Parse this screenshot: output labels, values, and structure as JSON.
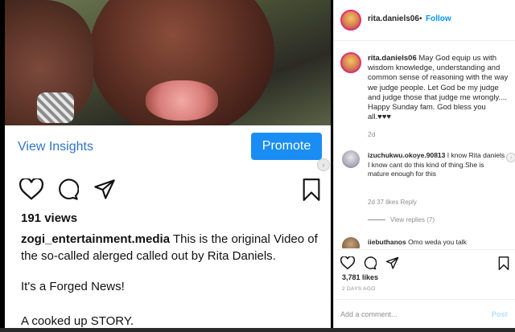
{
  "left_post": {
    "insights_label": "View Insights",
    "promote_label": "Promote",
    "views": "191 views",
    "caption_user": "zogi_entertainment.media",
    "caption_text": " This is the original Video of the so-called alerged called out by Rita Daniels.",
    "line2": "It's a Forged News!",
    "line3": "A cooked up STORY."
  },
  "right_panel": {
    "header": {
      "username": "rita.daniels06",
      "separator": "•",
      "follow_label": "Follow"
    },
    "comments": [
      {
        "username": "rita.daniels06",
        "text": " May God equip us with wisdom knowledge, understanding and common sense of reasoning with the way we judge people. Let God be my judge and judge those that judge me wrongly.... Happy Sunday fam. God bless you all.♥♥♥",
        "time": "2d"
      },
      {
        "username": "izuchukwu.okoye.90813",
        "text": " I know Rita daniels I know cant do this kind of thing.She is mature enough for this",
        "meta": "2d   37 likes   Reply",
        "replies": "View replies (7)"
      },
      {
        "username": "iiebuthanos",
        "text": " Omo weda you talk"
      }
    ],
    "likes": "3,781 likes",
    "time_ago": "2 DAYS AGO",
    "add_comment_placeholder": "Add a comment...",
    "post_label": "Post"
  },
  "colors": {
    "accent_blue": "#0095f6",
    "promote_bg": "#1a8df4",
    "insights_text": "#2e74c5"
  }
}
